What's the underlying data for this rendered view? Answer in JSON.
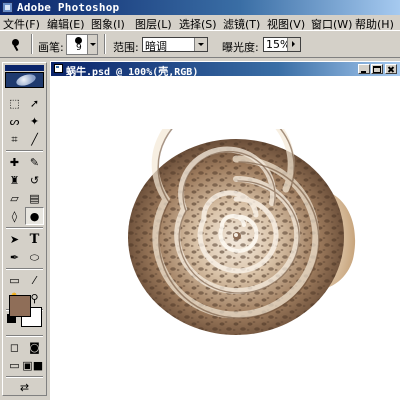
{
  "app": {
    "title": "Adobe Photoshop",
    "icon": "photoshop-app-icon"
  },
  "menu": [
    {
      "id": "file",
      "label": "文件(F)"
    },
    {
      "id": "edit",
      "label": "编辑(E)"
    },
    {
      "id": "image",
      "label": "图象(I)"
    },
    {
      "id": "layer",
      "label": "图层(L)"
    },
    {
      "id": "select",
      "label": "选择(S)"
    },
    {
      "id": "filter",
      "label": "滤镜(T)"
    },
    {
      "id": "view",
      "label": "视图(V)"
    },
    {
      "id": "window",
      "label": "窗口(W)"
    },
    {
      "id": "help",
      "label": "帮助(H)"
    }
  ],
  "options": {
    "tool_icon": "burn-tool-icon",
    "brush_label": "画笔:",
    "brush_size": "9",
    "range_label": "范围:",
    "range_value": "暗调",
    "exposure_label": "曝光度:",
    "exposure_value": "15%"
  },
  "toolbox": {
    "tools": [
      {
        "name": "marquee-tool",
        "glyph": "⬚"
      },
      {
        "name": "move-tool",
        "glyph": "➚"
      },
      {
        "name": "lasso-tool",
        "glyph": "ᔕ"
      },
      {
        "name": "magic-wand-tool",
        "glyph": "✦"
      },
      {
        "name": "crop-tool",
        "glyph": "⌗"
      },
      {
        "name": "slice-tool",
        "glyph": "╱"
      },
      {
        "name": "healing-brush-tool",
        "glyph": "✚"
      },
      {
        "name": "brush-tool",
        "glyph": "✎"
      },
      {
        "name": "clone-stamp-tool",
        "glyph": "♜"
      },
      {
        "name": "history-brush-tool",
        "glyph": "↺"
      },
      {
        "name": "eraser-tool",
        "glyph": "▱"
      },
      {
        "name": "gradient-tool",
        "glyph": "▤"
      },
      {
        "name": "blur-tool",
        "glyph": "◊"
      },
      {
        "name": "burn-tool",
        "glyph": "●"
      },
      {
        "name": "path-selection-tool",
        "glyph": "➤"
      },
      {
        "name": "type-tool",
        "glyph": "T"
      },
      {
        "name": "pen-tool",
        "glyph": "✒"
      },
      {
        "name": "shape-tool",
        "glyph": "⬭"
      },
      {
        "name": "notes-tool",
        "glyph": "▭"
      },
      {
        "name": "eyedropper-tool",
        "glyph": "⁄"
      },
      {
        "name": "hand-tool",
        "glyph": "✋"
      },
      {
        "name": "zoom-tool",
        "glyph": "⚲"
      }
    ],
    "foreground_color": "#8f6e58",
    "background_color": "#ffffff",
    "bottom_tools": [
      {
        "name": "standard-mode-icon",
        "glyph": "◻"
      },
      {
        "name": "quick-mask-mode-icon",
        "glyph": "◙"
      },
      {
        "name": "standard-screen-mode-icon",
        "glyph": "▭"
      },
      {
        "name": "full-screen-menu-mode-icon",
        "glyph": "▣"
      },
      {
        "name": "full-screen-mode-icon",
        "glyph": "■"
      },
      {
        "name": "jump-to-imageready-icon",
        "glyph": "⇄"
      }
    ]
  },
  "document": {
    "title": "蜗牛.psd @ 100%(壳,RGB)",
    "content": "snail-shell-image"
  }
}
